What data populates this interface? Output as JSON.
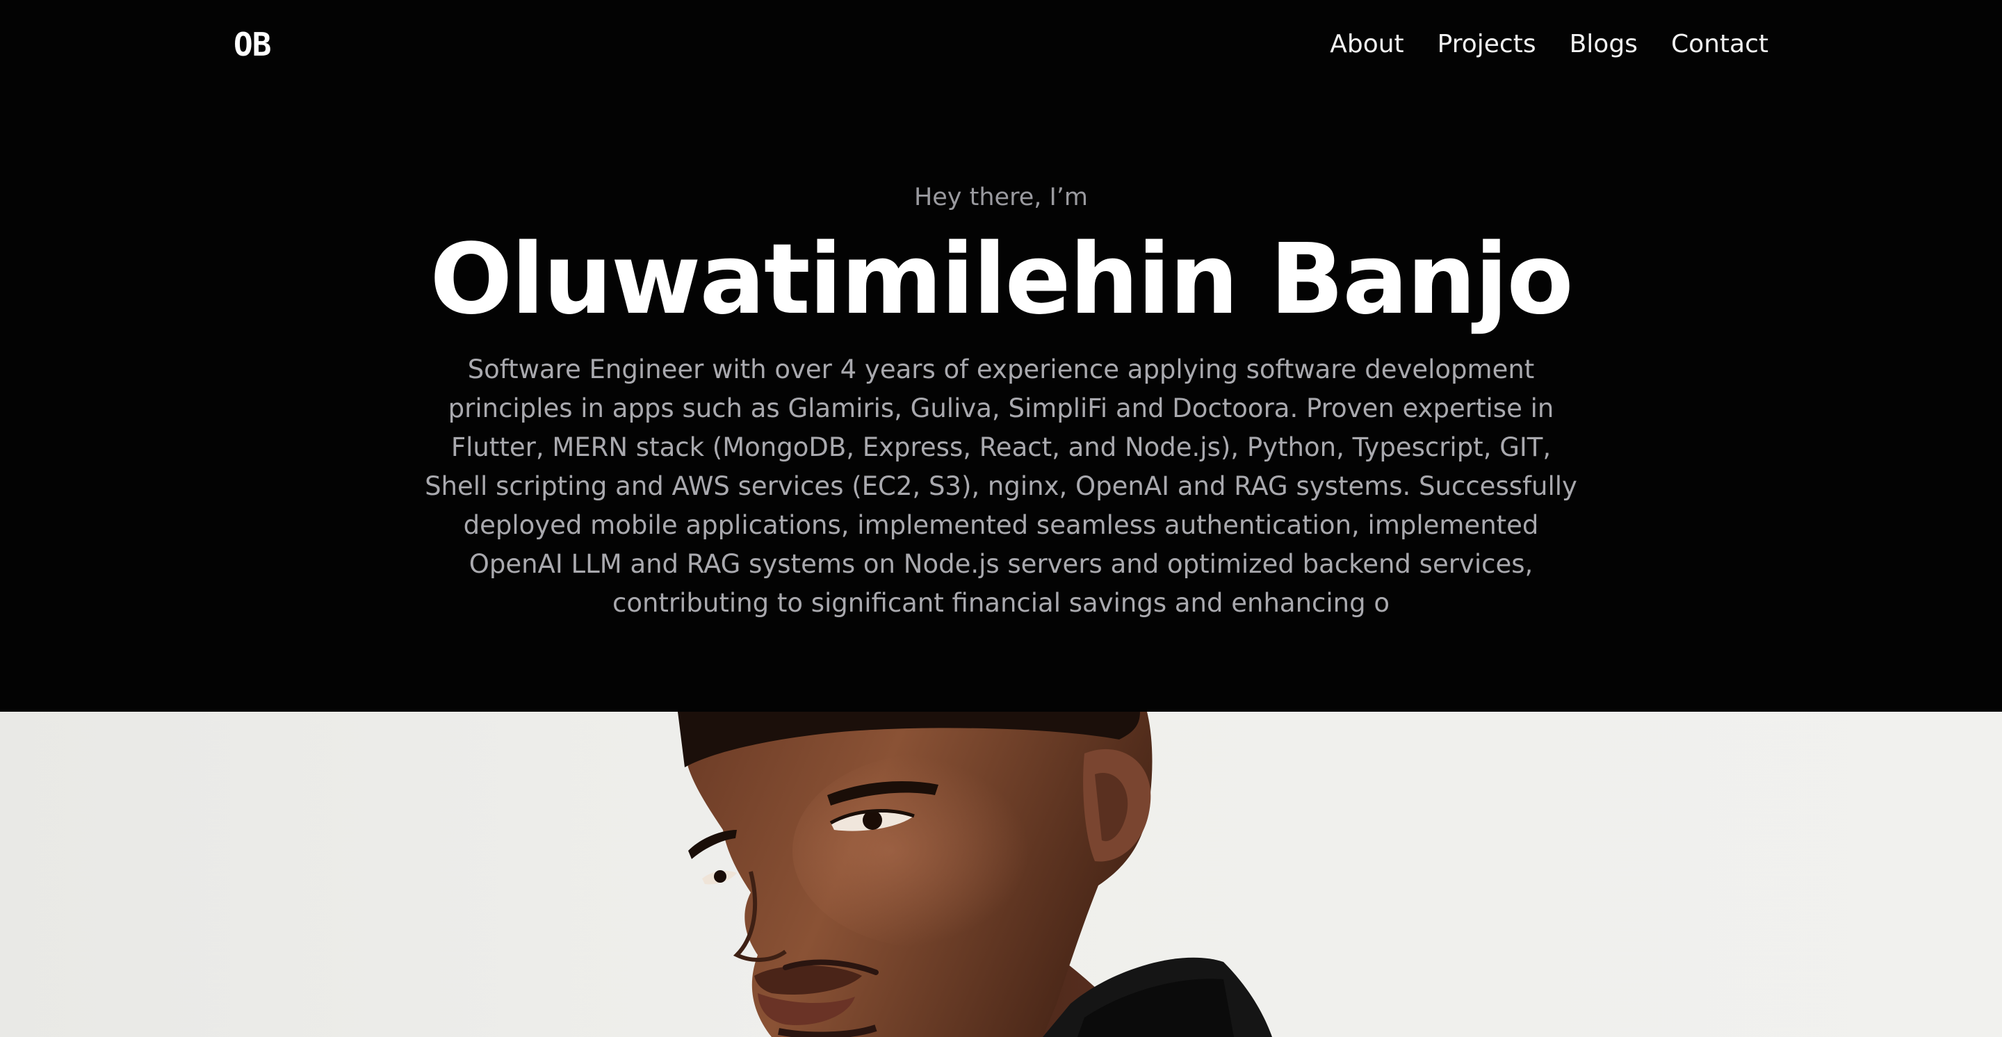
{
  "header": {
    "logo": "OB",
    "nav": [
      {
        "label": "About"
      },
      {
        "label": "Projects"
      },
      {
        "label": "Blogs"
      },
      {
        "label": "Contact"
      }
    ]
  },
  "hero": {
    "greeting": "Hey there, I’m",
    "name": "Oluwatimilehin Banjo",
    "bio": "Software Engineer with over 4 years of experience applying software development principles in apps such as Glamiris, Guliva, SimpliFi and Doctoora. Proven expertise in Flutter, MERN stack (MongoDB, Express, React, and Node.js), Python, Typescript, GIT, Shell scripting and AWS services (EC2, S3), nginx, OpenAI and RAG systems. Successfully deployed mobile applications, implemented seamless authentication, implemented OpenAI LLM and RAG systems on Node.js servers and optimized backend services, contributing to significant financial savings and enhancing o"
  },
  "colors": {
    "background": "#030303",
    "heading": "#ffffff",
    "muted_text": "#a9a9ae",
    "photo_background": "#efefec"
  }
}
